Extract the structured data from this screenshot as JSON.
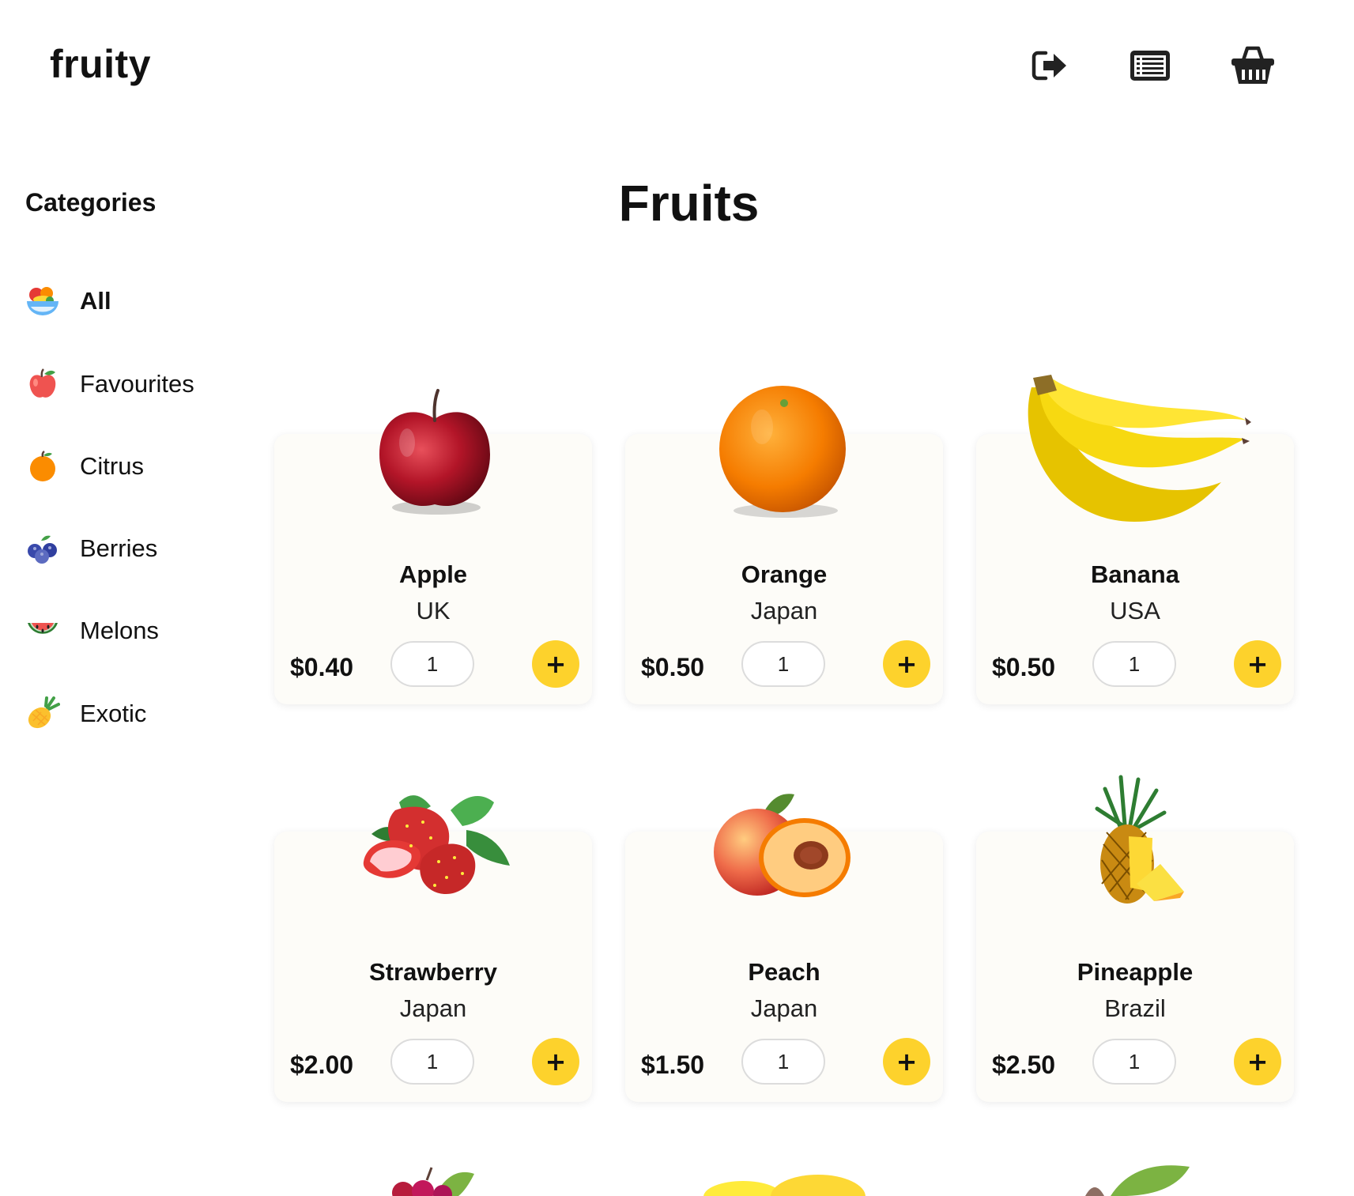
{
  "app": {
    "logo": "fruity"
  },
  "header": {
    "icons": [
      {
        "name": "logout-icon"
      },
      {
        "name": "orders-list-icon"
      },
      {
        "name": "basket-icon"
      }
    ]
  },
  "sidebar": {
    "title": "Categories",
    "items": [
      {
        "label": "All",
        "icon": "fruit-bowl-icon",
        "active": true
      },
      {
        "label": "Favourites",
        "icon": "apple-icon",
        "active": false
      },
      {
        "label": "Citrus",
        "icon": "orange-icon",
        "active": false
      },
      {
        "label": "Berries",
        "icon": "blueberries-icon",
        "active": false
      },
      {
        "label": "Melons",
        "icon": "watermelon-icon",
        "active": false
      },
      {
        "label": "Exotic",
        "icon": "pineapple-icon",
        "active": false
      }
    ]
  },
  "main": {
    "title": "Fruits",
    "products": [
      {
        "name": "Apple",
        "origin": "UK",
        "price": "$0.40",
        "qty": "1",
        "add_label": "+"
      },
      {
        "name": "Orange",
        "origin": "Japan",
        "price": "$0.50",
        "qty": "1",
        "add_label": "+"
      },
      {
        "name": "Banana",
        "origin": "USA",
        "price": "$0.50",
        "qty": "1",
        "add_label": "+"
      },
      {
        "name": "Strawberry",
        "origin": "Japan",
        "price": "$2.00",
        "qty": "1",
        "add_label": "+"
      },
      {
        "name": "Peach",
        "origin": "Japan",
        "price": "$1.50",
        "qty": "1",
        "add_label": "+"
      },
      {
        "name": "Pineapple",
        "origin": "Brazil",
        "price": "$2.50",
        "qty": "1",
        "add_label": "+"
      }
    ]
  },
  "colors": {
    "accent": "#fdd22c",
    "card_bg": "#fdfcf8",
    "text": "#111111"
  }
}
